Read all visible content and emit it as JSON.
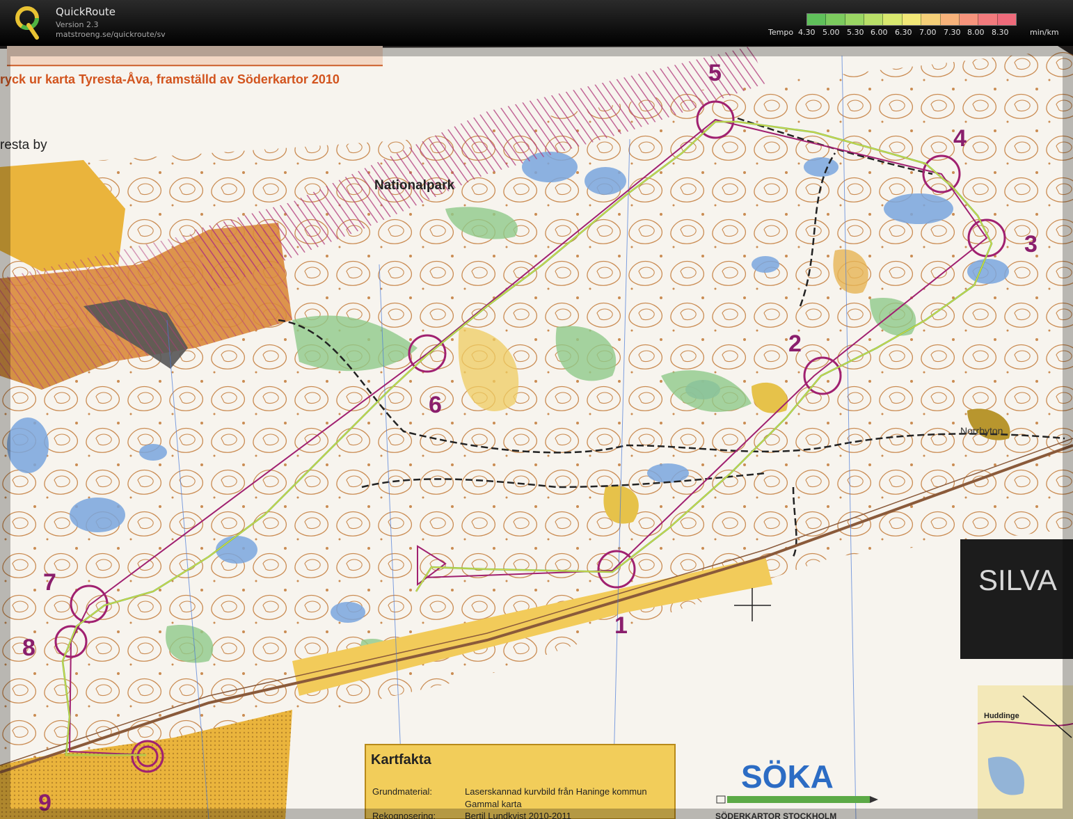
{
  "app": {
    "name": "QuickRoute",
    "version": "Version 2.3",
    "url": "matstroeng.se/quickroute/sv"
  },
  "legend": {
    "label": "Tempo",
    "ticks": [
      "4.30",
      "5.00",
      "5.30",
      "6.00",
      "6.30",
      "7.00",
      "7.30",
      "8.00",
      "8.30"
    ],
    "unit": "min/km",
    "colors": [
      "#5fc05a",
      "#7ccb5e",
      "#9ad663",
      "#b9df68",
      "#d8e86e",
      "#f2e877",
      "#f5cf78",
      "#f7b27a",
      "#f7947c",
      "#f27a7c",
      "#ee6a7a"
    ]
  },
  "map": {
    "header_text": "ryck ur karta Tyresta-Åva, framställd av Söderkartor 2010",
    "place_tyresta": "resta by",
    "place_nationalpark": "Nationalpark",
    "place_norrbyn": "Norrbyton",
    "silva_text": "SILVA",
    "huddinge_text": "Huddinge",
    "soka_logo": "SÖKA",
    "soka_sub": "SÖDERKARTOR  STOCKHOLM",
    "kartfakta": {
      "title": "Kartfakta",
      "rows": [
        {
          "label": "Grundmaterial:",
          "value": "Laserskannad kurvbild från Haninge kommun"
        },
        {
          "label": "",
          "value": "Gammal karta"
        },
        {
          "label": "Rekognosering:",
          "value": "Bertil Lundkvist 2010-2011"
        }
      ]
    },
    "controls": [
      "1",
      "2",
      "3",
      "4",
      "5",
      "6",
      "7",
      "8",
      "9"
    ],
    "colors": {
      "paper": "#f7f4ee",
      "course": "#a02070",
      "contour": "#b86a2a",
      "water": "#7aa6de",
      "green": "#8ec98a",
      "yellow": "#eab43c"
    }
  }
}
